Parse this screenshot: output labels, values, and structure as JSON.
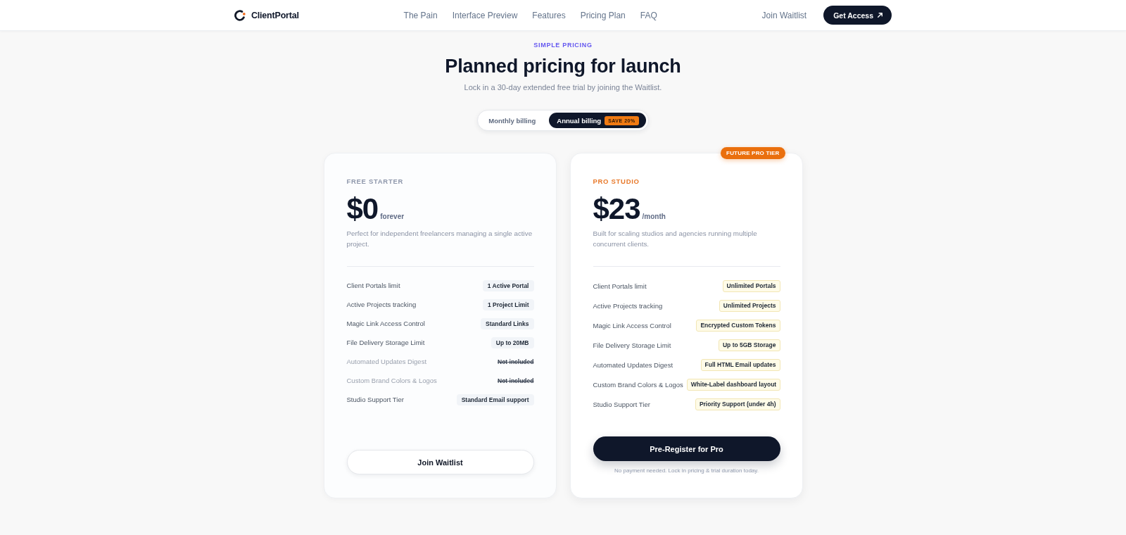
{
  "header": {
    "logo_text": "ClientPortal",
    "nav": [
      "The Pain",
      "Interface Preview",
      "Features",
      "Pricing Plan",
      "FAQ"
    ],
    "secondary_link": "Join Waitlist",
    "cta": "Get Access"
  },
  "pricing": {
    "eyebrow": "SIMPLE PRICING",
    "title": "Planned pricing for launch",
    "subtitle": "Lock in a 30-day extended free trial by joining the Waitlist.",
    "billing_toggle": [
      {
        "label": "Monthly billing",
        "selected": false
      },
      {
        "label": "Annual billing",
        "selected": true,
        "badge": "SAVE 20%"
      }
    ],
    "plans": [
      {
        "kind": "basic",
        "name": "FREE STARTER",
        "price": "$0",
        "period": "forever",
        "description": "Perfect for independent freelancers managing a single active project.",
        "features": [
          {
            "label": "Client Portals limit",
            "value": "1 Active Portal",
            "included": true
          },
          {
            "label": "Active Projects tracking",
            "value": "1 Project Limit",
            "included": true
          },
          {
            "label": "Magic Link Access Control",
            "value": "Standard Links",
            "included": true
          },
          {
            "label": "File Delivery Storage Limit",
            "value": "Up to 20MB",
            "included": true
          },
          {
            "label": "Automated Updates Digest",
            "value": "Not included",
            "included": false
          },
          {
            "label": "Custom Brand Colors & Logos",
            "value": "Not included",
            "included": false
          },
          {
            "label": "Studio Support Tier",
            "value": "Standard Email support",
            "included": true
          }
        ],
        "button": "Join Waitlist"
      },
      {
        "kind": "featured",
        "ribbon": "FUTURE PRO TIER",
        "name": "PRO STUDIO",
        "price": "$23",
        "period": "/month",
        "description": "Built for scaling studios and agencies running multiple concurrent clients.",
        "features": [
          {
            "label": "Client Portals limit",
            "value": "Unlimited Portals",
            "included": true
          },
          {
            "label": "Active Projects tracking",
            "value": "Unlimited Projects",
            "included": true
          },
          {
            "label": "Magic Link Access Control",
            "value": "Encrypted Custom Tokens",
            "included": true
          },
          {
            "label": "File Delivery Storage Limit",
            "value": "Up to 5GB Storage",
            "included": true
          },
          {
            "label": "Automated Updates Digest",
            "value": "Full HTML Email updates",
            "included": true
          },
          {
            "label": "Custom Brand Colors & Logos",
            "value": "White-Label dashboard layout",
            "included": true
          },
          {
            "label": "Studio Support Tier",
            "value": "Priority Support (under 4h)",
            "included": true
          }
        ],
        "button": "Pre-Register for Pro",
        "note": "No payment needed. Lock in pricing & trial duration today."
      }
    ]
  }
}
